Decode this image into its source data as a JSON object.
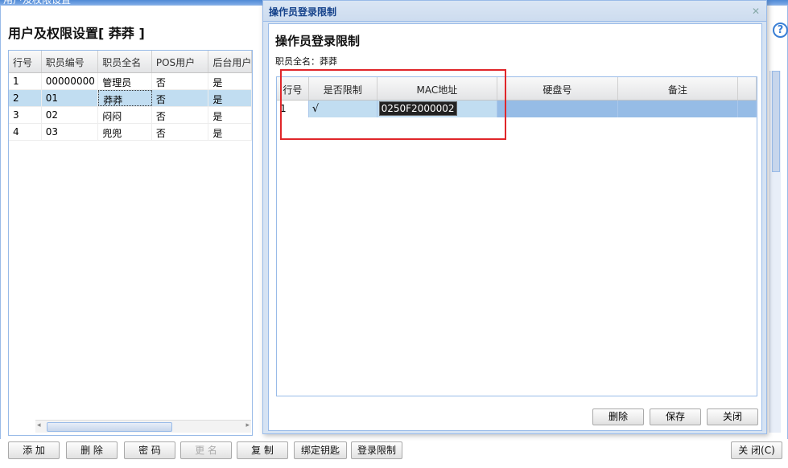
{
  "background": {
    "window_title": "用户及权限设置",
    "page_title": "用户及权限设置[ 莽莽 ]",
    "user_grid": {
      "columns": [
        "行号",
        "职员编号",
        "职员全名",
        "POS用户",
        "后台用户"
      ],
      "rows": [
        [
          "1",
          "00000000",
          "管理员",
          "否",
          "是"
        ],
        [
          "2",
          "01",
          "莽莽",
          "否",
          "是"
        ],
        [
          "3",
          "02",
          "闷闷",
          "否",
          "是"
        ],
        [
          "4",
          "03",
          "兜兜",
          "否",
          "是"
        ]
      ],
      "selected_row": 1
    },
    "buttons": {
      "add": "添 加",
      "delete": "删 除",
      "password": "密 码",
      "rename": "更 名",
      "copy": "复 制",
      "bind_key": "绑定钥匙",
      "login_limit": "登录限制",
      "close": "关 闭(C)"
    },
    "help_icon": "question-circle-icon"
  },
  "modal": {
    "window_title": "操作员登录限制",
    "title": "操作员登录限制",
    "subtitle": "职员全名：莽莽",
    "close_glyph": "✕",
    "grid": {
      "columns": [
        "行号",
        "是否限制",
        "MAC地址",
        "硬盘号",
        "备注"
      ],
      "rows": [
        [
          "1",
          "√",
          "0250F2000002",
          "",
          ""
        ]
      ]
    },
    "buttons": {
      "delete": "删除",
      "save": "保存",
      "close": "关闭"
    }
  },
  "colors": {
    "accent": "#15428b",
    "selection": "#c1ddf1",
    "highlight": "#e0262a"
  }
}
